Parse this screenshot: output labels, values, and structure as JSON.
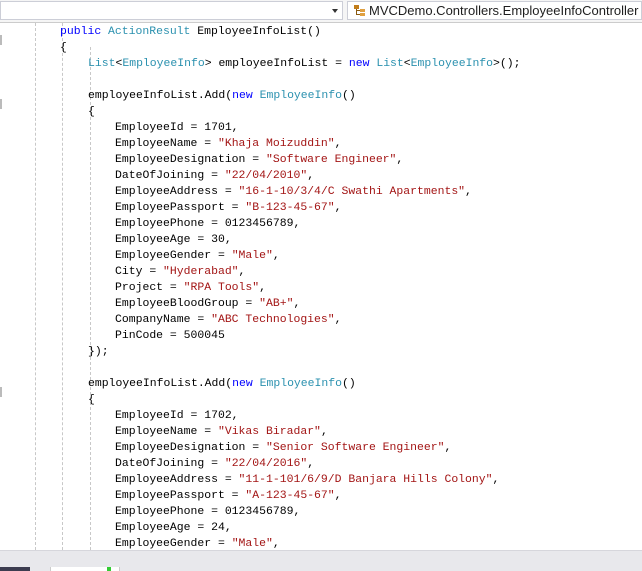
{
  "navigation_bar": {
    "left_dropdown": "",
    "right_dropdown": "MVCDemo.Controllers.EmployeeInfoController",
    "right_icon": "class-icon"
  },
  "colors": {
    "keyword": "#0000ff",
    "type": "#2b91af",
    "string": "#a31515",
    "plain": "#000000"
  },
  "code_lines": [
    {
      "indent": 0,
      "tokens": [
        [
          "public ",
          "kw"
        ],
        [
          "ActionResult",
          "ty"
        ],
        [
          " EmployeeInfoList()",
          "pl"
        ]
      ]
    },
    {
      "indent": 0,
      "tokens": [
        [
          "{",
          "pl"
        ]
      ]
    },
    {
      "indent": 1,
      "tokens": [
        [
          "List",
          "ty"
        ],
        [
          "<",
          "pl"
        ],
        [
          "EmployeeInfo",
          "ty"
        ],
        [
          "> employeeInfoList = ",
          "pl"
        ],
        [
          "new ",
          "kw"
        ],
        [
          "List",
          "ty"
        ],
        [
          "<",
          "pl"
        ],
        [
          "EmployeeInfo",
          "ty"
        ],
        [
          ">();",
          "pl"
        ]
      ]
    },
    {
      "indent": 1,
      "tokens": []
    },
    {
      "indent": 1,
      "tokens": [
        [
          "employeeInfoList.Add(",
          "pl"
        ],
        [
          "new ",
          "kw"
        ],
        [
          "EmployeeInfo",
          "ty"
        ],
        [
          "()",
          "pl"
        ]
      ]
    },
    {
      "indent": 1,
      "tokens": [
        [
          "{",
          "pl"
        ]
      ]
    },
    {
      "indent": 2,
      "tokens": [
        [
          "EmployeeId = 1701,",
          "pl"
        ]
      ]
    },
    {
      "indent": 2,
      "tokens": [
        [
          "EmployeeName = ",
          "pl"
        ],
        [
          "\"Khaja Moizuddin\"",
          "st"
        ],
        [
          ",",
          "pl"
        ]
      ]
    },
    {
      "indent": 2,
      "tokens": [
        [
          "EmployeeDesignation = ",
          "pl"
        ],
        [
          "\"Software Engineer\"",
          "st"
        ],
        [
          ",",
          "pl"
        ]
      ]
    },
    {
      "indent": 2,
      "tokens": [
        [
          "DateOfJoining = ",
          "pl"
        ],
        [
          "\"22/04/2010\"",
          "st"
        ],
        [
          ",",
          "pl"
        ]
      ]
    },
    {
      "indent": 2,
      "tokens": [
        [
          "EmployeeAddress = ",
          "pl"
        ],
        [
          "\"16-1-10/3/4/C Swathi Apartments\"",
          "st"
        ],
        [
          ",",
          "pl"
        ]
      ]
    },
    {
      "indent": 2,
      "tokens": [
        [
          "EmployeePassport = ",
          "pl"
        ],
        [
          "\"B-123-45-67\"",
          "st"
        ],
        [
          ",",
          "pl"
        ]
      ]
    },
    {
      "indent": 2,
      "tokens": [
        [
          "EmployeePhone = 0123456789,",
          "pl"
        ]
      ]
    },
    {
      "indent": 2,
      "tokens": [
        [
          "EmployeeAge = 30,",
          "pl"
        ]
      ]
    },
    {
      "indent": 2,
      "tokens": [
        [
          "EmployeeGender = ",
          "pl"
        ],
        [
          "\"Male\"",
          "st"
        ],
        [
          ",",
          "pl"
        ]
      ]
    },
    {
      "indent": 2,
      "tokens": [
        [
          "City = ",
          "pl"
        ],
        [
          "\"Hyderabad\"",
          "st"
        ],
        [
          ",",
          "pl"
        ]
      ]
    },
    {
      "indent": 2,
      "tokens": [
        [
          "Project = ",
          "pl"
        ],
        [
          "\"RPA Tools\"",
          "st"
        ],
        [
          ",",
          "pl"
        ]
      ]
    },
    {
      "indent": 2,
      "tokens": [
        [
          "EmployeeBloodGroup = ",
          "pl"
        ],
        [
          "\"AB+\"",
          "st"
        ],
        [
          ",",
          "pl"
        ]
      ]
    },
    {
      "indent": 2,
      "tokens": [
        [
          "CompanyName = ",
          "pl"
        ],
        [
          "\"ABC Technologies\"",
          "st"
        ],
        [
          ",",
          "pl"
        ]
      ]
    },
    {
      "indent": 2,
      "tokens": [
        [
          "PinCode = 500045",
          "pl"
        ]
      ]
    },
    {
      "indent": 1,
      "tokens": [
        [
          "});",
          "pl"
        ]
      ]
    },
    {
      "indent": 1,
      "tokens": []
    },
    {
      "indent": 1,
      "tokens": [
        [
          "employeeInfoList.Add(",
          "pl"
        ],
        [
          "new ",
          "kw"
        ],
        [
          "EmployeeInfo",
          "ty"
        ],
        [
          "()",
          "pl"
        ]
      ]
    },
    {
      "indent": 1,
      "tokens": [
        [
          "{",
          "pl"
        ]
      ]
    },
    {
      "indent": 2,
      "tokens": [
        [
          "EmployeeId = 1702,",
          "pl"
        ]
      ]
    },
    {
      "indent": 2,
      "tokens": [
        [
          "EmployeeName = ",
          "pl"
        ],
        [
          "\"Vikas Biradar\"",
          "st"
        ],
        [
          ",",
          "pl"
        ]
      ]
    },
    {
      "indent": 2,
      "tokens": [
        [
          "EmployeeDesignation = ",
          "pl"
        ],
        [
          "\"Senior Software Engineer\"",
          "st"
        ],
        [
          ",",
          "pl"
        ]
      ]
    },
    {
      "indent": 2,
      "tokens": [
        [
          "DateOfJoining = ",
          "pl"
        ],
        [
          "\"22/04/2016\"",
          "st"
        ],
        [
          ",",
          "pl"
        ]
      ]
    },
    {
      "indent": 2,
      "tokens": [
        [
          "EmployeeAddress = ",
          "pl"
        ],
        [
          "\"11-1-101/6/9/D Banjara Hills Colony\"",
          "st"
        ],
        [
          ",",
          "pl"
        ]
      ]
    },
    {
      "indent": 2,
      "tokens": [
        [
          "EmployeePassport = ",
          "pl"
        ],
        [
          "\"A-123-45-67\"",
          "st"
        ],
        [
          ",",
          "pl"
        ]
      ]
    },
    {
      "indent": 2,
      "tokens": [
        [
          "EmployeePhone = 0123456789,",
          "pl"
        ]
      ]
    },
    {
      "indent": 2,
      "tokens": [
        [
          "EmployeeAge = 24,",
          "pl"
        ]
      ]
    },
    {
      "indent": 2,
      "tokens": [
        [
          "EmployeeGender = ",
          "pl"
        ],
        [
          "\"Male\"",
          "st"
        ],
        [
          ",",
          "pl"
        ]
      ]
    }
  ]
}
